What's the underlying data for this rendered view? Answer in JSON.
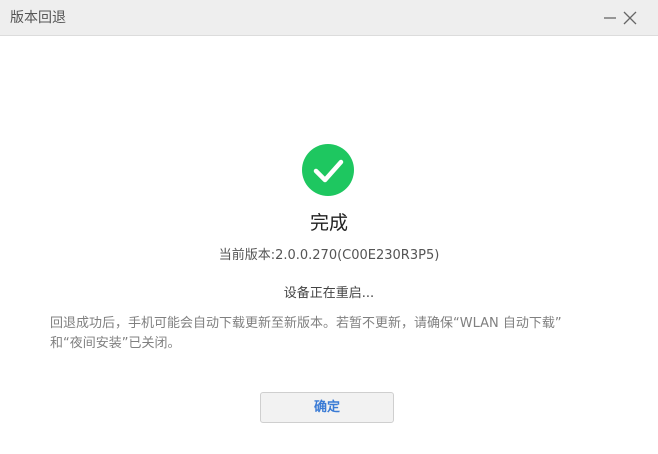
{
  "window": {
    "title": "版本回退",
    "minimize_icon": "minimize-icon",
    "close_icon": "close-icon"
  },
  "result": {
    "icon": "check-circle-icon",
    "icon_color": "#1ec760",
    "title": "完成",
    "version": "当前版本:2.0.0.270(C00E230R3P5)",
    "restart_status": "设备正在重启...",
    "notice_line1": "回退成功后，手机可能会自动下载更新至新版本。若暂不更新，请确保“WLAN 自动下载”",
    "notice_line2": "和“夜间安装”已关闭。"
  },
  "actions": {
    "confirm_label": "确定",
    "confirm_color": "#3a7bd5"
  }
}
